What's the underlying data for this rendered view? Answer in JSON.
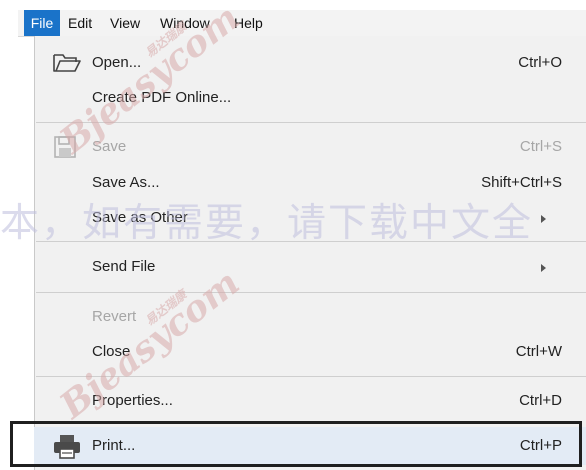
{
  "menubar": {
    "items": [
      {
        "label": "File",
        "active": true
      },
      {
        "label": "Edit"
      },
      {
        "label": "View"
      },
      {
        "label": "Window"
      },
      {
        "label": "Help"
      }
    ]
  },
  "menu": {
    "items": [
      {
        "label": "Open...",
        "shortcut": "Ctrl+O",
        "icon": "folder-open-icon"
      },
      {
        "label": "Create PDF Online..."
      },
      {
        "label": "Save",
        "shortcut": "Ctrl+S",
        "icon": "save-icon",
        "disabled": true
      },
      {
        "label": "Save As...",
        "shortcut": "Shift+Ctrl+S"
      },
      {
        "label": "Save as Other",
        "submenu": true
      },
      {
        "label": "Send File",
        "submenu": true
      },
      {
        "label": "Revert",
        "disabled": true
      },
      {
        "label": "Close",
        "shortcut": "Ctrl+W"
      },
      {
        "label": "Properties...",
        "shortcut": "Ctrl+D"
      },
      {
        "label": "Print...",
        "shortcut": "Ctrl+P",
        "icon": "printer-icon",
        "highlighted": true
      }
    ]
  },
  "watermarks": {
    "logo_text": "Bjeasycom",
    "logo_cn": "易达瑞康",
    "banner": "本，如有需要，请下载中文全"
  },
  "colors": {
    "menubar_bg": "#f3f3f3",
    "active_menu": "#1a73c9",
    "menu_bg": "#f1f1f1",
    "highlight": "#e3ebf5",
    "disabled_text": "#a6a6a6"
  }
}
